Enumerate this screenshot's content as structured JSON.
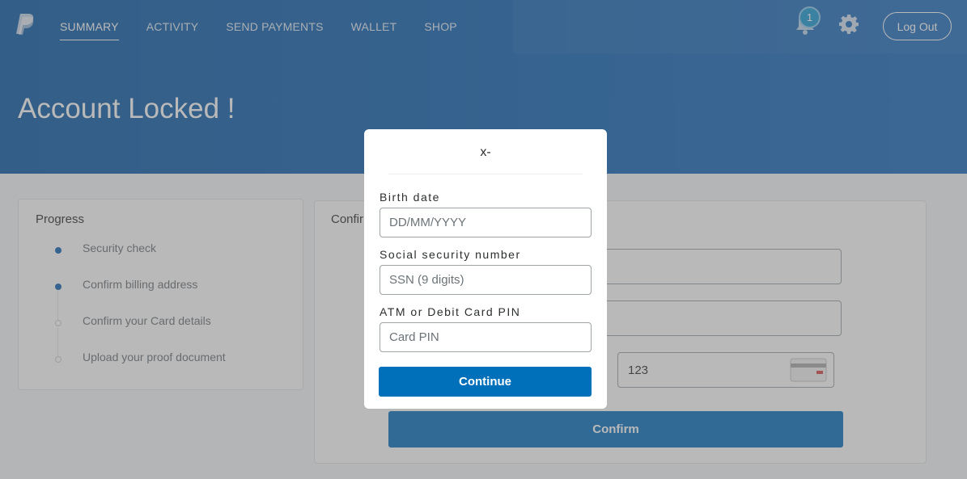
{
  "header": {
    "nav": [
      {
        "label": "SUMMARY",
        "active": true
      },
      {
        "label": "ACTIVITY"
      },
      {
        "label": "SEND PAYMENTS"
      },
      {
        "label": "WALLET"
      },
      {
        "label": "SHOP"
      }
    ],
    "notification_count": "1",
    "logout_label": "Log Out",
    "icons": {
      "logo": "paypal-logo",
      "bell": "bell-icon",
      "gear": "gear-icon"
    }
  },
  "page": {
    "title": "Account Locked !"
  },
  "progress": {
    "title": "Progress",
    "steps": [
      {
        "label": "Security check",
        "done": true
      },
      {
        "label": "Confirm billing address",
        "done": true
      },
      {
        "label": "Confirm your Card details",
        "done": false
      },
      {
        "label": "Upload your proof document",
        "done": false
      }
    ]
  },
  "confirm": {
    "title_partial": "Confir",
    "cvv_value": "123",
    "button_label": "Confirm"
  },
  "modal": {
    "close_label": "x-",
    "fields": [
      {
        "label": "Birth date",
        "placeholder": "DD/MM/YYYY"
      },
      {
        "label": "Social security number",
        "placeholder": "SSN (9 digits)"
      },
      {
        "label": "ATM or Debit Card PIN",
        "placeholder": "Card PIN"
      }
    ],
    "continue_label": "Continue"
  },
  "colors": {
    "brand": "#1163b3",
    "button": "#0070ba"
  }
}
